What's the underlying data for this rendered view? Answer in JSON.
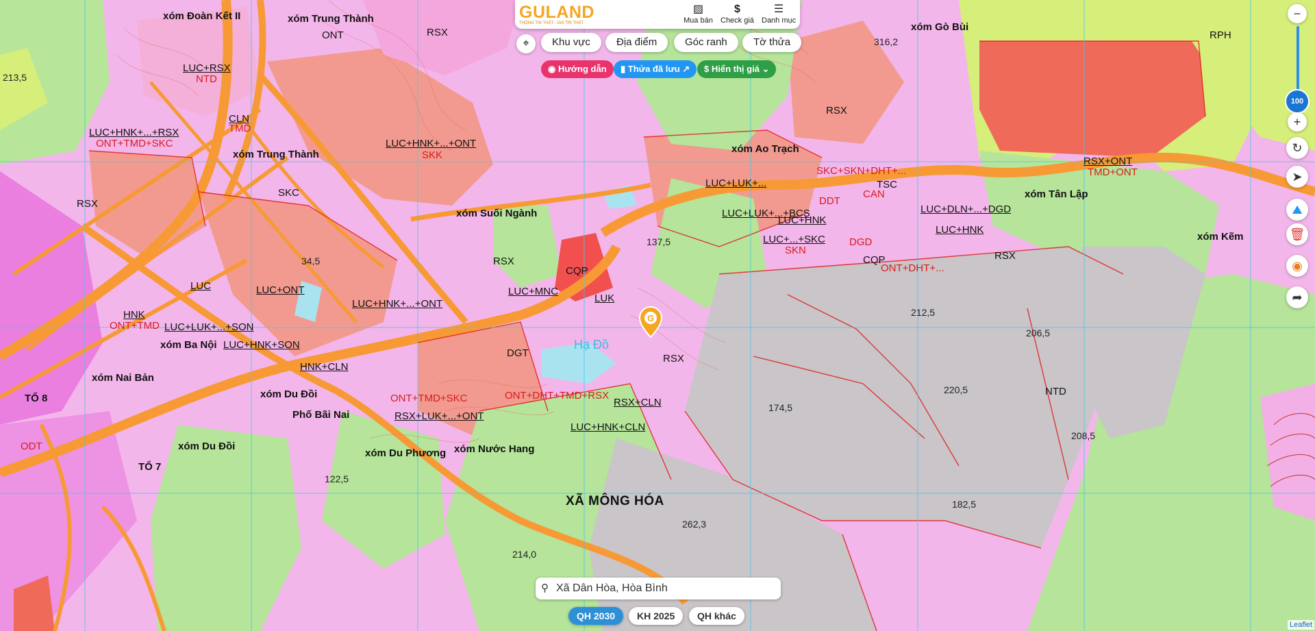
{
  "header": {
    "logo_text": "GULAND",
    "logo_tagline": "THÔNG TIN THẬT - GIÁ TRỊ THẬT",
    "buttons": [
      {
        "label": "Mua bán",
        "icon": "store-icon"
      },
      {
        "label": "Check giá",
        "icon": "dollar-icon"
      },
      {
        "label": "Danh mục",
        "icon": "menu-icon"
      }
    ]
  },
  "filters": {
    "khu_vuc": "Khu vực",
    "dia_diem": "Địa điểm",
    "goc_ranh": "Góc ranh",
    "to_thua": "Tờ thửa"
  },
  "chips": {
    "huong_dan": "Hướng dẫn",
    "thua_da_luu": "Thửa đã lưu",
    "hien_thi_gia": "Hiển thị giá"
  },
  "zoom": {
    "level": "100"
  },
  "search": {
    "value": "Xã Dân Hòa, Hòa Bình"
  },
  "plan_tabs": [
    {
      "label": "QH 2030",
      "active": true
    },
    {
      "label": "KH 2025",
      "active": false
    },
    {
      "label": "QH khác",
      "active": false
    }
  ],
  "attribution": "Leaflet",
  "map": {
    "commune": "XÃ MÔNG HÓA",
    "places": [
      "xóm Đoàn Kết II",
      "xóm Trung Thành",
      "xóm Trung Thành",
      "xóm Suối Ngành",
      "xóm Ba Nội",
      "xóm Nai Bản",
      "xóm Du Đồi",
      "Phố Bãi Nai",
      "xóm Du Đồi",
      "xóm Du Phương",
      "xóm Nước Hang",
      "xóm Ao Trạch",
      "xóm Tân Lập",
      "xóm Kẽm",
      "xóm Gò Bùi",
      "TỔ 8",
      "TỔ 7",
      "Hạ Đồ"
    ],
    "land_codes": [
      "RSX",
      "ONT",
      "LUC+RSX",
      "NTD",
      "CLN",
      "TMD",
      "LUC+HNK+...+RSX",
      "ONT+TMD+SKC",
      "LUC+HNK+...+ONT",
      "SKK",
      "SKC",
      "RSX",
      "LUC",
      "ODT",
      "HNK",
      "ONT+TMD",
      "LUC+LUK+...+SON",
      "LUC+ONT",
      "LUC+HNK+SON",
      "LUC+HNK+...+ONT",
      "HNK+CLN",
      "DGT",
      "RSX",
      "LUC+MNC",
      "CQP",
      "LUK",
      "ONT+TMD+SKC",
      "RSX+LUK+...+ONT",
      "ONT+DHT+TMD+RSX",
      "RSX+CLN",
      "LUC+HNK+CLN",
      "RSX",
      "TSC",
      "LUC+HNK",
      "LUC+LUK+...",
      "LUC+LUK+...+BCS",
      "LUC+...+SKC",
      "RSX+ONT",
      "RSX",
      "NTD",
      "SKN",
      "DGD",
      "ONT+DHT+...",
      "LUC+DLN+...+DGD",
      "LUC+HNK",
      "CAN",
      "DDT",
      "SKC+SKN+DHT+...",
      "RPH",
      "RSX",
      "CQP",
      "TMD+ONT"
    ],
    "elevations": [
      "34,5",
      "137,5",
      "212,5",
      "206,5",
      "220,5",
      "174,5",
      "208,5",
      "182,5",
      "262,3",
      "214,0",
      "122,5",
      "316,2",
      "213,5"
    ]
  }
}
